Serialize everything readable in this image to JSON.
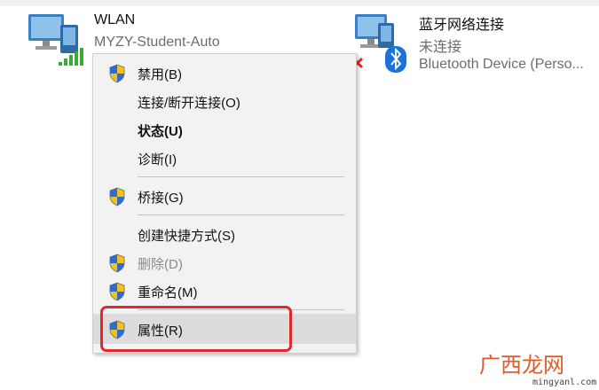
{
  "adapters": [
    {
      "name": "WLAN",
      "line1": "MYZY-Student-Auto",
      "line2": "",
      "icon": "wifi-network-icon"
    },
    {
      "name": "蓝牙网络连接",
      "line1": "未连接",
      "line2": "Bluetooth Device (Perso...",
      "icon": "bluetooth-network-icon"
    }
  ],
  "context_menu": {
    "items": [
      {
        "label": "禁用(B)",
        "shield": true
      },
      {
        "label": "连接/断开连接(O)",
        "shield": false
      },
      {
        "label": "状态(U)",
        "shield": false,
        "bold": true
      },
      {
        "label": "诊断(I)",
        "shield": false
      },
      {
        "label": "桥接(G)",
        "shield": true
      },
      {
        "label": "创建快捷方式(S)",
        "shield": false
      },
      {
        "label": "删除(D)",
        "shield": true,
        "disabled": true
      },
      {
        "label": "重命名(M)",
        "shield": true
      },
      {
        "label": "属性(R)",
        "shield": true,
        "highlighted": true
      }
    ]
  },
  "watermark": {
    "text": "广西龙网",
    "url": "mingyanl.com"
  },
  "colors": {
    "highlight_box": "#e0292b",
    "watermark": "#e15a29",
    "bluetooth": "#1a73d9"
  }
}
